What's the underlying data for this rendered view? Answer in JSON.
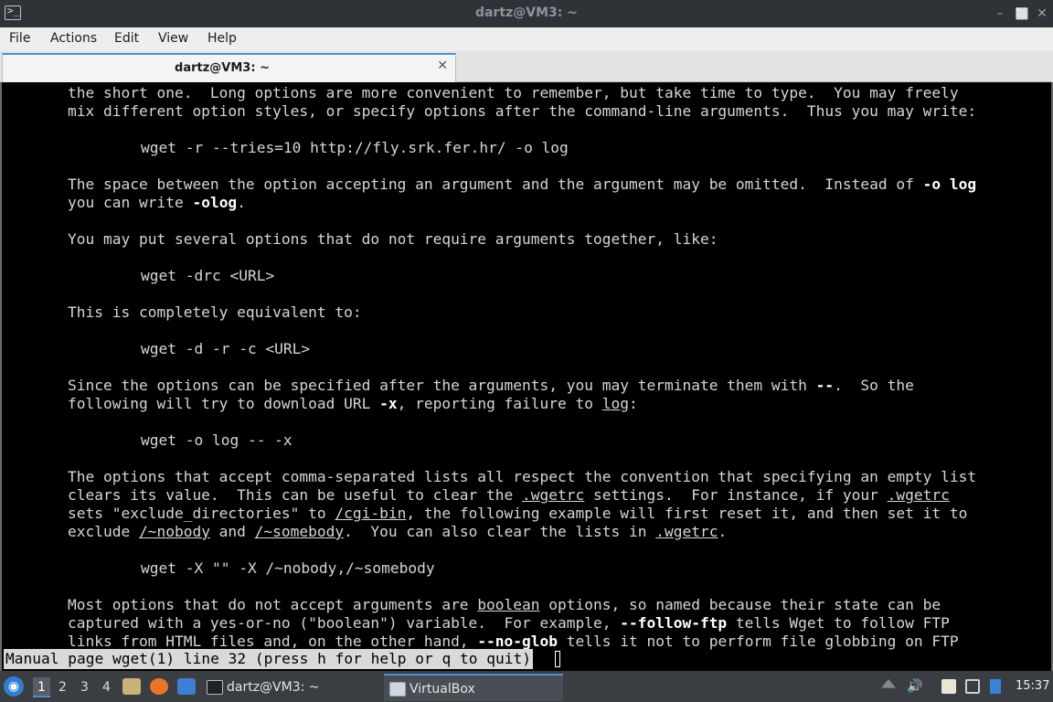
{
  "window": {
    "title": "dartz@VM3: ~",
    "controls": {
      "minimize": "–",
      "maximize": "⬜",
      "close": "✕"
    }
  },
  "menu": [
    "File",
    "Actions",
    "Edit",
    "View",
    "Help"
  ],
  "tab": {
    "label": "dartz@VM3: ~",
    "close": "✕"
  },
  "terminal": {
    "lines": [
      [
        {
          "t": "the short one.  Long options are more convenient to remember, but take time to type.  You may freely"
        }
      ],
      [
        {
          "t": "mix different option styles, or specify options after the command-line arguments.  Thus you may write:"
        }
      ],
      [
        {
          "t": "wget -r --tries=10 http://fly.srk.fer.hr/ -o log"
        }
      ],
      [
        {
          "t": "The space between the option accepting an argument and the argument may be omitted.  Instead of "
        },
        {
          "t": "-o log",
          "s": "b"
        }
      ],
      [
        {
          "t": "you can write "
        },
        {
          "t": "-olog",
          "s": "b"
        },
        {
          "t": "."
        }
      ],
      [
        {
          "t": "You may put several options that do not require arguments together, like:"
        }
      ],
      [
        {
          "t": "wget -drc <URL>"
        }
      ],
      [
        {
          "t": "This is completely equivalent to:"
        }
      ],
      [
        {
          "t": "wget -d -r -c <URL>"
        }
      ],
      [
        {
          "t": "Since the options can be specified after the arguments, you may terminate them with "
        },
        {
          "t": "--",
          "s": "b"
        },
        {
          "t": ".  So the"
        }
      ],
      [
        {
          "t": "following will try to download URL "
        },
        {
          "t": "-x",
          "s": "b"
        },
        {
          "t": ", reporting failure to "
        },
        {
          "t": "log",
          "s": "u"
        },
        {
          "t": ":"
        }
      ],
      [
        {
          "t": "wget -o log -- -x"
        }
      ],
      [
        {
          "t": "The options that accept comma-separated lists all respect the convention that specifying an empty list"
        }
      ],
      [
        {
          "t": "clears its value.  This can be useful to clear the "
        },
        {
          "t": ".wgetrc",
          "s": "u"
        },
        {
          "t": " settings.  For instance, if your "
        },
        {
          "t": ".wgetrc",
          "s": "u"
        }
      ],
      [
        {
          "t": "sets \"exclude_directories\" to "
        },
        {
          "t": "/cgi-bin",
          "s": "u"
        },
        {
          "t": ", the following example will first reset it, and then set it to"
        }
      ],
      [
        {
          "t": "exclude "
        },
        {
          "t": "/~nobody",
          "s": "u"
        },
        {
          "t": " and "
        },
        {
          "t": "/~somebody",
          "s": "u"
        },
        {
          "t": ".  You can also clear the lists in "
        },
        {
          "t": ".wgetrc",
          "s": "u"
        },
        {
          "t": "."
        }
      ],
      [
        {
          "t": "wget -X \"\" -X /~nobody,/~somebody"
        }
      ],
      [
        {
          "t": "Most options that do not accept arguments are "
        },
        {
          "t": "boolean",
          "s": "u"
        },
        {
          "t": " options, so named because their state can be"
        }
      ],
      [
        {
          "t": "captured with a yes-or-no (\"boolean\") variable.  For example, "
        },
        {
          "t": "--follow-ftp",
          "s": "b"
        },
        {
          "t": " tells Wget to follow FTP"
        }
      ],
      [
        {
          "t": "links from HTML files and, on the other hand, "
        },
        {
          "t": "--no-glob",
          "s": "b"
        },
        {
          "t": " tells it not to perform file globbing on FTP"
        }
      ]
    ],
    "status": "Manual page wget(1) line 32 (press h for help or q to quit)"
  },
  "taskbar": {
    "workspaces": [
      "1",
      "2",
      "3",
      "4"
    ],
    "tasks": [
      "dartz@VM3: ~",
      "VirtualBox"
    ],
    "clock": "15:37"
  }
}
